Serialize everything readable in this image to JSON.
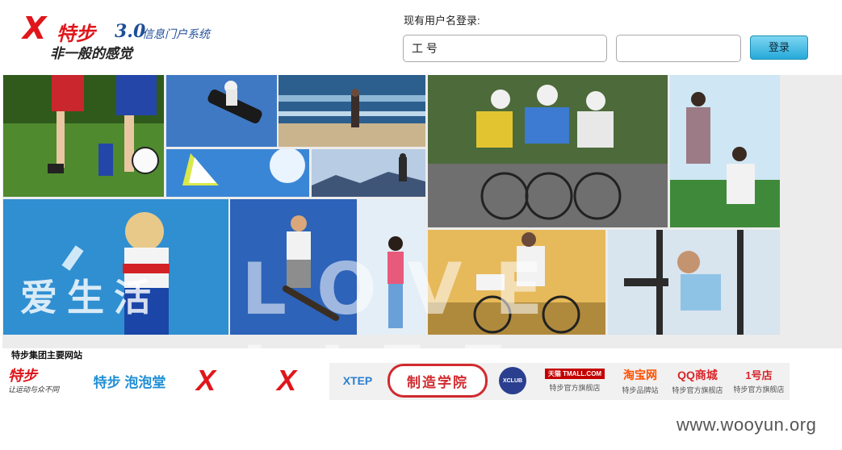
{
  "header": {
    "logo": {
      "mark": "X",
      "brand": "特步",
      "version": "3.0",
      "system": "信息门户系统",
      "slogan": "非一般的感觉"
    },
    "login_label": "现有用户名登录:",
    "username_value": "工 号",
    "password_value": "",
    "login_button": "登录"
  },
  "banner": {
    "overlay_cn": "爱生活",
    "overlay_en": "LOVE LIFE"
  },
  "sites": {
    "title": "特步集团主要网站",
    "items": [
      {
        "id": "xtep-fun",
        "line1": "特步",
        "line2": "让运动与众不同"
      },
      {
        "id": "paopaotang",
        "line1": "特步 泡泡堂"
      },
      {
        "id": "xtep-logo-1",
        "line1": "X"
      },
      {
        "id": "xtep-logo-2",
        "line1": "X"
      },
      {
        "id": "xtep-en",
        "line1": "XTEP"
      },
      {
        "id": "college",
        "line1": "制造学院"
      },
      {
        "id": "xclub",
        "line1": "XCLUB"
      },
      {
        "id": "tmall",
        "line1": "天猫 TMALL.COM",
        "line2": "特步官方旗舰店"
      },
      {
        "id": "taobao",
        "line1": "淘宝网",
        "line2": "特步品牌站"
      },
      {
        "id": "qq",
        "line1": "QQ商城",
        "line2": "特步官方旗舰店"
      },
      {
        "id": "yihaodian",
        "line1": "1号店",
        "line2": "特步官方旗舰店"
      }
    ]
  },
  "watermark": "www.wooyun.org",
  "colors": {
    "brand_red": "#e0161b",
    "brand_blue": "#1f4e9a",
    "button_blue": "#26a9d9"
  }
}
